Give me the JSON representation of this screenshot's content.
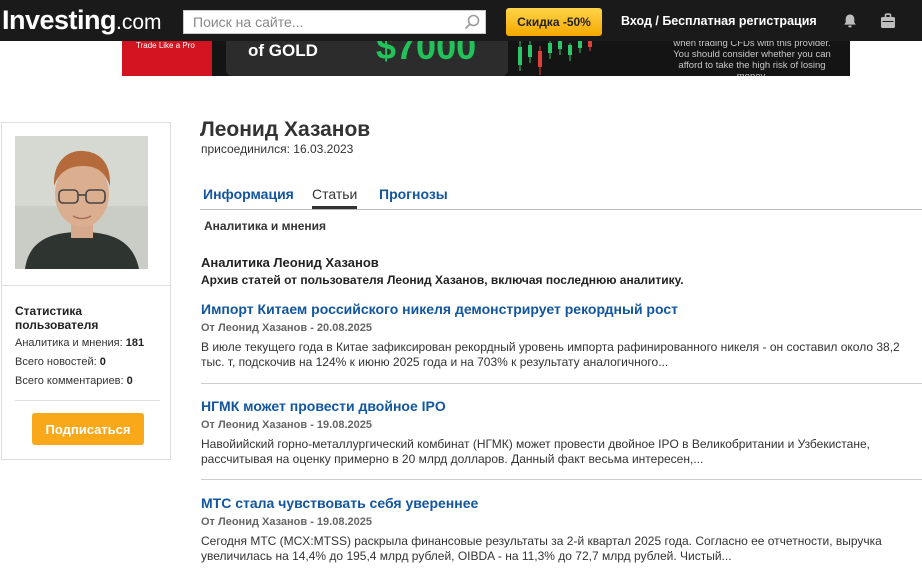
{
  "header": {
    "logo_main": "Investing",
    "logo_suffix": ".com",
    "search_placeholder": "Поиск на сайте...",
    "promo_label": "Скидка -50%",
    "login_label": "Вход / Бесплатная регистрация"
  },
  "banner": {
    "tagline": "Trade Like a Pro",
    "headline": "of GOLD",
    "amount": "$7000",
    "disclaimer_line1": "when trading CFDs with this provider.",
    "disclaimer_line2": "You should consider whether you can",
    "disclaimer_line3": "afford to take the high risk of losing money."
  },
  "profile": {
    "name": "Леонид Хазанов",
    "joined": "присоединился: 16.03.2023"
  },
  "sidebar": {
    "stats_title": "Статистика пользователя",
    "stats": [
      {
        "label": "Аналитика и мнения:",
        "value": "181"
      },
      {
        "label": "Всего новостей:",
        "value": "0"
      },
      {
        "label": "Всего комментариев:",
        "value": "0"
      }
    ],
    "subscribe_label": "Подписаться"
  },
  "tabs": [
    {
      "label": "Информация",
      "active": false
    },
    {
      "label": "Статьи",
      "active": true
    },
    {
      "label": "Прогнозы",
      "active": false
    }
  ],
  "subnav": "Аналитика и мнения",
  "section": {
    "title": "Аналитика Леонид Хазанов",
    "description": "Архив статей от пользователя Леонид Хазанов, включая последнюю аналитику."
  },
  "articles": [
    {
      "title": "Импорт Китаем российского никеля демонстрирует рекордный рост",
      "meta": "От Леонид Хазанов - 20.08.2025",
      "snippet": "В июле текущего года в Китае зафиксирован рекордный уровень импорта рафинированного никеля - он составил около 38,2 тыс. т, подскочив на 124% к июню 2025 года и на 703% к результату аналогичного..."
    },
    {
      "title": "НГМК может провести двойное IPO",
      "meta": "От Леонид Хазанов - 19.08.2025",
      "snippet": "Навойийский горно-металлургический комбинат (НГМК) может провести двойное IPO в Великобритании и Узбекистане, рассчитывая на оценку примерно в 20 млрд долларов.   Данный факт весьма интересен,..."
    },
    {
      "title": "МТС стала чувствовать себя увереннее",
      "meta": "От Леонид Хазанов - 19.08.2025",
      "snippet": "Сегодня МТС (MCX:MTSS) раскрыла финансовые результаты за 2-й квартал 2025 года. Согласно ее отчетности, выручка увеличилась на 14,4% до 195,4 млрд рублей, OIBDA - на 11,3% до 72,7 млрд рублей. Чистый..."
    }
  ]
}
